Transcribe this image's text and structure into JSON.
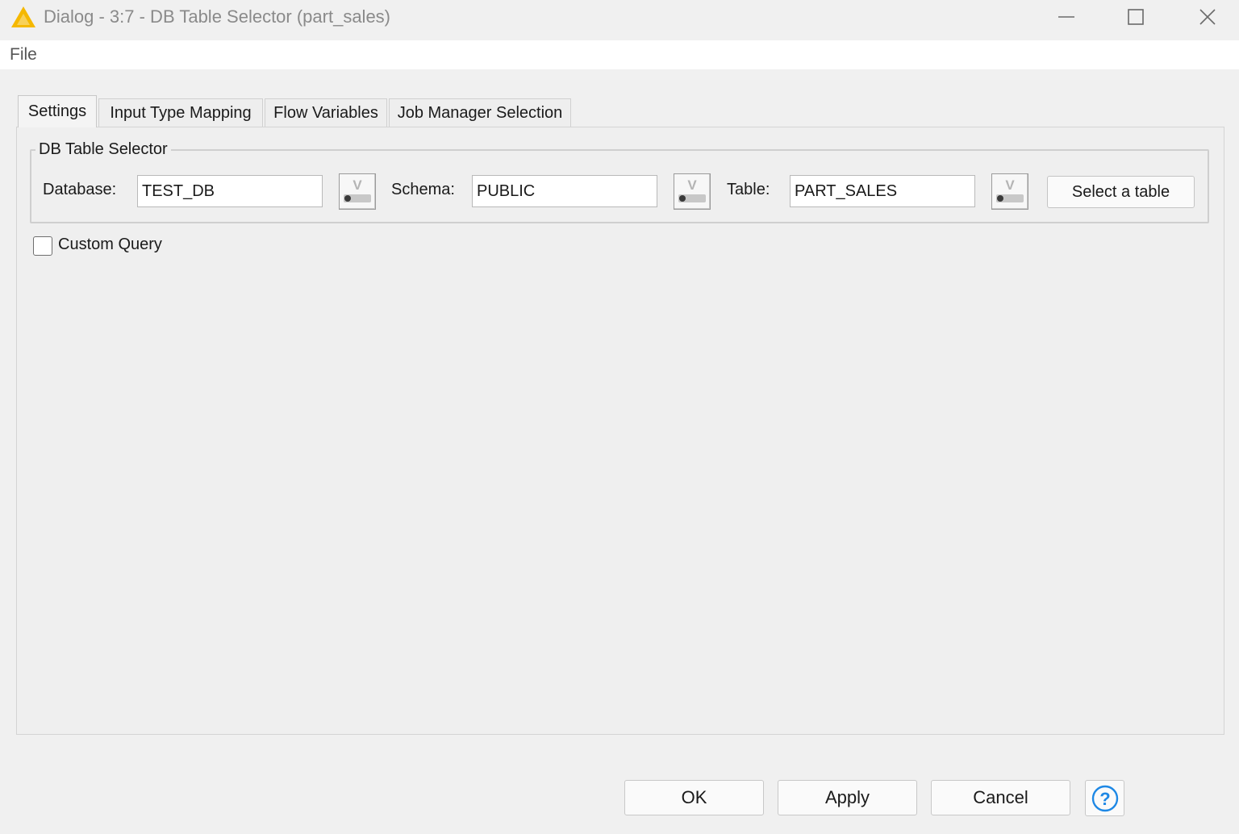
{
  "window": {
    "title": "Dialog - 3:7 - DB Table Selector (part_sales)",
    "icon": "knime-warning-triangle-icon",
    "accent_color": "#f5b800"
  },
  "menu": {
    "file_label": "File"
  },
  "tabs": [
    {
      "label": "Settings",
      "active": true
    },
    {
      "label": "Input Type Mapping",
      "active": false
    },
    {
      "label": "Flow Variables",
      "active": false
    },
    {
      "label": "Job Manager Selection",
      "active": false
    }
  ],
  "db_table_selector": {
    "group_title": "DB Table Selector",
    "database": {
      "label": "Database:",
      "value": "TEST_DB"
    },
    "schema": {
      "label": "Schema:",
      "value": "PUBLIC"
    },
    "table": {
      "label": "Table:",
      "value": "PART_SALES"
    },
    "flow_variable_button_glyph": "V",
    "select_table_label": "Select a table"
  },
  "custom_query": {
    "label": "Custom Query",
    "checked": false
  },
  "footer": {
    "ok_label": "OK",
    "apply_label": "Apply",
    "cancel_label": "Cancel",
    "help_icon": "help-circle-icon",
    "help_color": "#1e88e5"
  }
}
